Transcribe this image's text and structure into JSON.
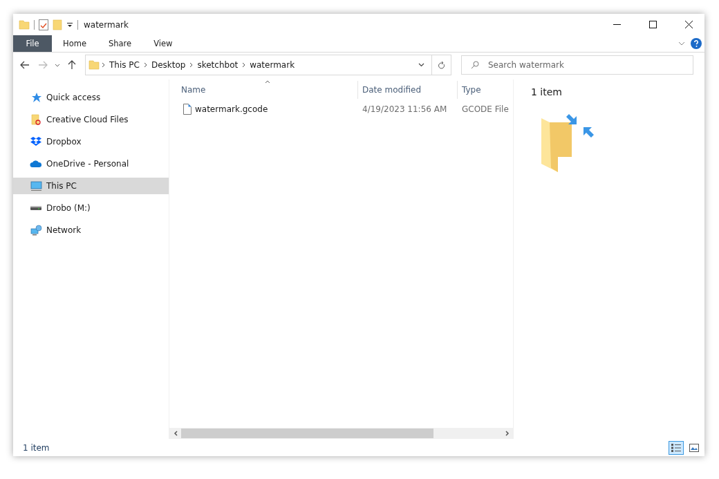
{
  "window": {
    "title": "watermark"
  },
  "ribbon": {
    "tabs": [
      {
        "label": "File",
        "kind": "file"
      },
      {
        "label": "Home",
        "kind": "tab"
      },
      {
        "label": "Share",
        "kind": "tab"
      },
      {
        "label": "View",
        "kind": "tab"
      }
    ]
  },
  "address_bar": {
    "path": [
      "This PC",
      "Desktop",
      "sketchbot",
      "watermark"
    ]
  },
  "search": {
    "placeholder": "Search watermark"
  },
  "sidebar": {
    "items": [
      {
        "label": "Quick access",
        "kind": "star",
        "selected": false
      },
      {
        "label": "Creative Cloud Files",
        "kind": "cloudfolder",
        "selected": false
      },
      {
        "label": "Dropbox",
        "kind": "dropbox",
        "selected": false
      },
      {
        "label": "OneDrive - Personal",
        "kind": "onedrive",
        "selected": false
      },
      {
        "label": "This PC",
        "kind": "pc",
        "selected": true
      },
      {
        "label": "Drobo (M:)",
        "kind": "drive",
        "selected": false
      },
      {
        "label": "Network",
        "kind": "network",
        "selected": false
      }
    ]
  },
  "table": {
    "columns": [
      "Name",
      "Date modified",
      "Type"
    ],
    "rows": [
      {
        "cells": [
          "watermark.gcode",
          "4/19/2023 11:56 AM",
          "GCODE File"
        ]
      }
    ]
  },
  "preview": {
    "text": "1 item"
  },
  "status_bar": {
    "text": "1 item",
    "views": [
      {
        "kind": "details",
        "selected": true
      },
      {
        "kind": "tiles",
        "selected": false
      }
    ]
  }
}
